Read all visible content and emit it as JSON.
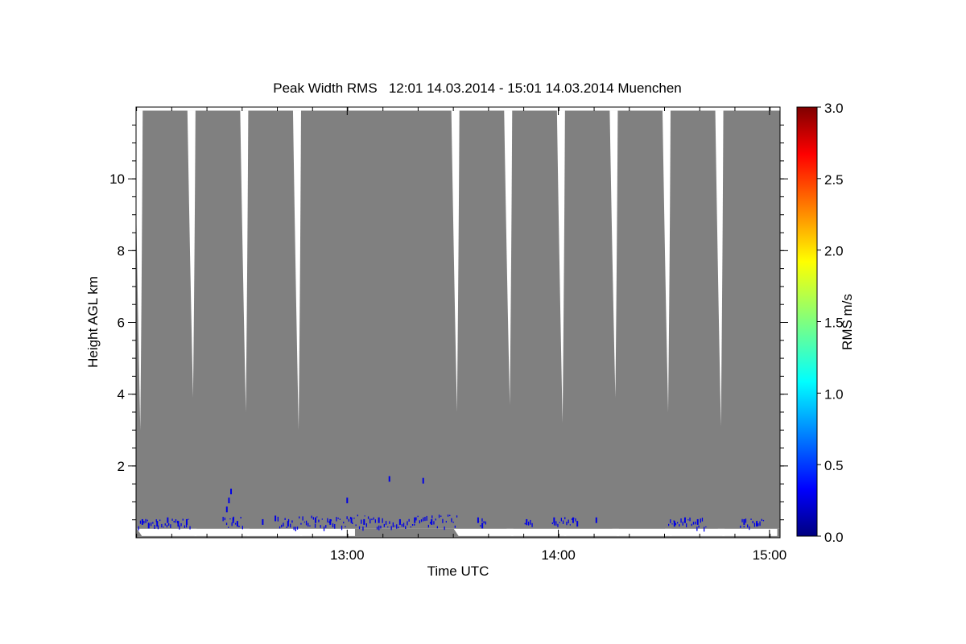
{
  "chart_data": {
    "type": "heatmap",
    "title": "Peak Width RMS   12:01 14.03.2014 - 15:01 14.03.2014 Muenchen",
    "xlabel": "Time UTC",
    "ylabel": "Height AGL km",
    "colorbar_label": "RMS m/s",
    "x_unit": "hours UTC",
    "xlim": [
      12.0,
      15.05
    ],
    "ylim": [
      0.0,
      12.0
    ],
    "x_ticks": [
      {
        "value": 13.0,
        "label": "13:00"
      },
      {
        "value": 14.0,
        "label": "14:00"
      },
      {
        "value": 15.0,
        "label": "15:00"
      }
    ],
    "x_minor_step": 0.1667,
    "y_ticks": [
      {
        "value": 2,
        "label": "2"
      },
      {
        "value": 4,
        "label": "4"
      },
      {
        "value": 6,
        "label": "6"
      },
      {
        "value": 8,
        "label": "8"
      },
      {
        "value": 10,
        "label": "10"
      }
    ],
    "y_minor_step": 0.5,
    "colorbar": {
      "min": 0.0,
      "max": 3.0,
      "colormap": "jet",
      "ticks": [
        {
          "value": 0.0,
          "label": "0.0"
        },
        {
          "value": 0.5,
          "label": "0.5"
        },
        {
          "value": 1.0,
          "label": "1.0"
        },
        {
          "value": 1.5,
          "label": "1.5"
        },
        {
          "value": 2.0,
          "label": "2.0"
        },
        {
          "value": 2.5,
          "label": "2.5"
        },
        {
          "value": 3.0,
          "label": "3.0"
        }
      ]
    },
    "no_data_color": "#808080",
    "data_top_km": 11.9,
    "data_bottom_km": 0.25,
    "gap_color": "#ffffff",
    "gaps": [
      {
        "time": 12.02,
        "cusp_height_km": 3.0
      },
      {
        "time": 12.27,
        "cusp_height_km": 3.9
      },
      {
        "time": 12.52,
        "cusp_height_km": 3.5
      },
      {
        "time": 12.77,
        "cusp_height_km": 3.0
      },
      {
        "time": 13.52,
        "cusp_height_km": 3.5
      },
      {
        "time": 13.77,
        "cusp_height_km": 3.7
      },
      {
        "time": 14.02,
        "cusp_height_km": 3.2
      },
      {
        "time": 14.27,
        "cusp_height_km": 3.9
      },
      {
        "time": 14.52,
        "cusp_height_km": 3.5
      },
      {
        "time": 14.77,
        "cusp_height_km": 3.1
      }
    ],
    "low_rms_points": [
      {
        "time": 12.03,
        "height": 0.45,
        "rms": 0.3
      },
      {
        "time": 12.06,
        "height": 0.35,
        "rms": 0.3
      },
      {
        "time": 12.1,
        "height": 0.4,
        "rms": 0.3
      },
      {
        "time": 12.15,
        "height": 0.5,
        "rms": 0.3
      },
      {
        "time": 12.2,
        "height": 0.4,
        "rms": 0.3
      },
      {
        "time": 12.24,
        "height": 0.45,
        "rms": 0.3
      },
      {
        "time": 12.43,
        "height": 0.8,
        "rms": 0.3
      },
      {
        "time": 12.44,
        "height": 1.05,
        "rms": 0.3
      },
      {
        "time": 12.45,
        "height": 1.3,
        "rms": 0.3
      },
      {
        "time": 12.46,
        "height": 0.5,
        "rms": 0.3
      },
      {
        "time": 12.48,
        "height": 0.4,
        "rms": 0.3
      },
      {
        "time": 12.6,
        "height": 0.45,
        "rms": 0.3
      },
      {
        "time": 12.66,
        "height": 0.55,
        "rms": 0.3
      },
      {
        "time": 12.72,
        "height": 0.4,
        "rms": 0.3
      },
      {
        "time": 12.85,
        "height": 0.5,
        "rms": 0.3
      },
      {
        "time": 12.92,
        "height": 0.45,
        "rms": 0.3
      },
      {
        "time": 13.0,
        "height": 1.05,
        "rms": 0.3
      },
      {
        "time": 13.02,
        "height": 0.5,
        "rms": 0.3
      },
      {
        "time": 13.08,
        "height": 0.45,
        "rms": 0.3
      },
      {
        "time": 13.15,
        "height": 0.5,
        "rms": 0.3
      },
      {
        "time": 13.2,
        "height": 1.65,
        "rms": 0.3
      },
      {
        "time": 13.25,
        "height": 0.45,
        "rms": 0.3
      },
      {
        "time": 13.32,
        "height": 0.5,
        "rms": 0.3
      },
      {
        "time": 13.36,
        "height": 1.6,
        "rms": 0.3
      },
      {
        "time": 13.4,
        "height": 0.45,
        "rms": 0.3
      },
      {
        "time": 13.62,
        "height": 0.5,
        "rms": 0.3
      },
      {
        "time": 13.64,
        "height": 0.35,
        "rms": 0.3
      },
      {
        "time": 13.85,
        "height": 0.45,
        "rms": 0.3
      },
      {
        "time": 13.98,
        "height": 0.5,
        "rms": 0.3
      },
      {
        "time": 14.07,
        "height": 0.5,
        "rms": 0.3
      },
      {
        "time": 14.09,
        "height": 0.4,
        "rms": 0.3
      },
      {
        "time": 14.18,
        "height": 0.5,
        "rms": 0.3
      },
      {
        "time": 14.55,
        "height": 0.4,
        "rms": 0.3
      },
      {
        "time": 14.6,
        "height": 0.5,
        "rms": 0.3
      },
      {
        "time": 14.66,
        "height": 0.45,
        "rms": 0.3
      },
      {
        "time": 14.88,
        "height": 0.45,
        "rms": 0.3
      },
      {
        "time": 14.94,
        "height": 0.4,
        "rms": 0.3
      }
    ],
    "low_rms_bands": [
      {
        "t0": 12.01,
        "t1": 12.26,
        "h0": 0.3,
        "h1": 0.55,
        "rms": 0.3
      },
      {
        "t0": 12.41,
        "t1": 12.51,
        "h0": 0.3,
        "h1": 0.6,
        "rms": 0.3
      },
      {
        "t0": 12.67,
        "t1": 13.52,
        "h0": 0.3,
        "h1": 0.65,
        "rms": 0.3
      },
      {
        "t0": 13.62,
        "t1": 13.66,
        "h0": 0.3,
        "h1": 0.55,
        "rms": 0.3
      },
      {
        "t0": 13.84,
        "t1": 13.88,
        "h0": 0.3,
        "h1": 0.5,
        "rms": 0.3
      },
      {
        "t0": 13.97,
        "t1": 14.08,
        "h0": 0.3,
        "h1": 0.6,
        "rms": 0.3
      },
      {
        "t0": 14.52,
        "t1": 14.7,
        "h0": 0.3,
        "h1": 0.6,
        "rms": 0.3
      },
      {
        "t0": 14.86,
        "t1": 14.97,
        "h0": 0.3,
        "h1": 0.55,
        "rms": 0.3
      }
    ]
  }
}
